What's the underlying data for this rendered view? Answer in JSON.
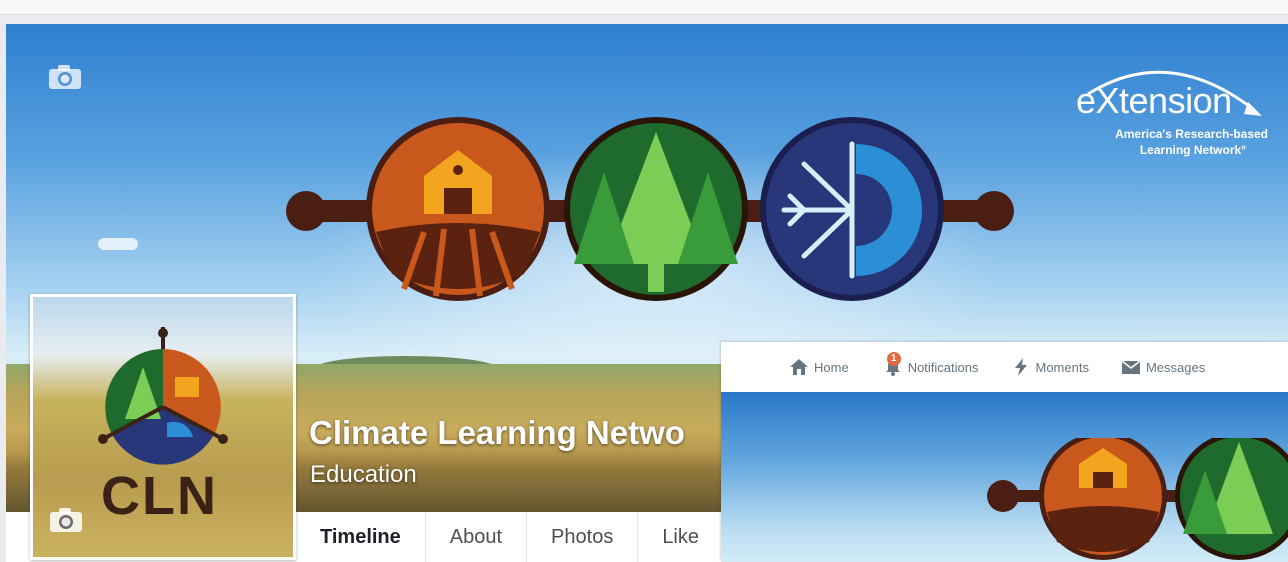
{
  "cover": {
    "extension_logo_word": "eXtension",
    "extension_tagline_1": "America's Research-based",
    "extension_tagline_2": "Learning Network°"
  },
  "profile": {
    "logo_text": "CLN",
    "name": "Climate Learning Netwo",
    "category": "Education"
  },
  "tabs": [
    {
      "label": "Timeline",
      "active": true
    },
    {
      "label": "About",
      "active": false
    },
    {
      "label": "Photos",
      "active": false
    },
    {
      "label": "Like",
      "active": false
    }
  ],
  "inset_nav": {
    "items": [
      {
        "label": "Home",
        "icon": "home-icon"
      },
      {
        "label": "Notifications",
        "icon": "bell-icon",
        "badge": "1"
      },
      {
        "label": "Moments",
        "icon": "lightning-icon"
      },
      {
        "label": "Messages",
        "icon": "envelope-icon"
      }
    ]
  },
  "colors": {
    "cover_sky": "#3d8ad6",
    "barn_orange": "#c9581c",
    "tree_green": "#1e6b2d",
    "snow_navy": "#283779",
    "connector": "#4a1e12",
    "notification_badge": "#e0693f"
  }
}
